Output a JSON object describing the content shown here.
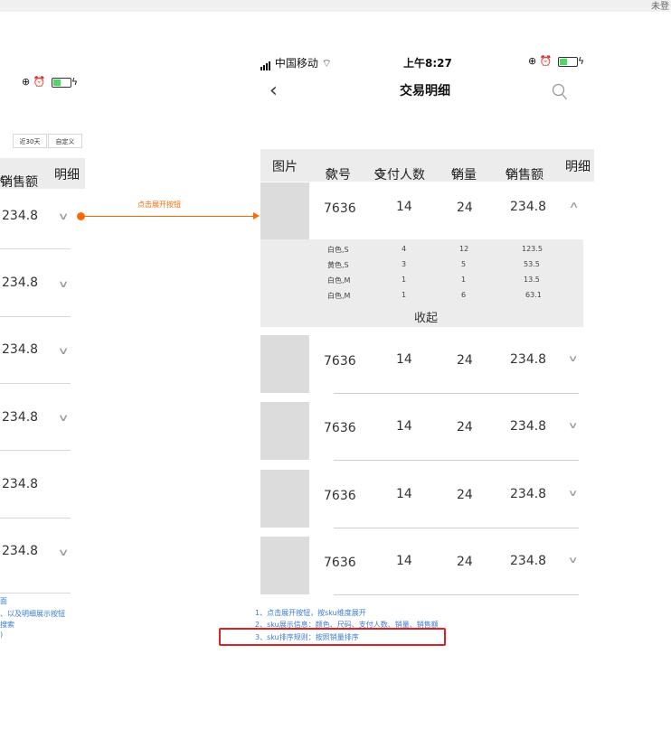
{
  "top_bar_text": "未登",
  "left_panel": {
    "filters": [
      "近30天",
      "自定义"
    ],
    "headers": {
      "sales_amount": "销售额",
      "detail": "明细"
    },
    "rows": [
      "234.8",
      "234.8",
      "234.8",
      "234.8",
      "234.8",
      "234.8"
    ],
    "notes": [
      "面",
      "、以及明细展示按钮",
      "搜索",
      ")"
    ]
  },
  "annotation": {
    "label": "点击展开按钮",
    "color": "#ff6a00"
  },
  "phone": {
    "carrier": "中国移动",
    "time": "上午8:27",
    "title": "交易明细",
    "headers": [
      "图片",
      "款号",
      "支付人数",
      "销量",
      "销售额",
      "明细"
    ],
    "rows": [
      {
        "code": "7636",
        "payers": "14",
        "sales": "24",
        "amount": "234.8"
      },
      {
        "code": "7636",
        "payers": "14",
        "sales": "24",
        "amount": "234.8"
      },
      {
        "code": "7636",
        "payers": "14",
        "sales": "24",
        "amount": "234.8"
      },
      {
        "code": "7636",
        "payers": "14",
        "sales": "24",
        "amount": "234.8"
      },
      {
        "code": "7636",
        "payers": "14",
        "sales": "24",
        "amount": "234.8"
      }
    ],
    "sku_rows": [
      {
        "sku": "白色,S",
        "payers": "4",
        "sales": "12",
        "amount": "123.5"
      },
      {
        "sku": "黄色,S",
        "payers": "3",
        "sales": "5",
        "amount": "53.5"
      },
      {
        "sku": "白色,M",
        "payers": "1",
        "sales": "1",
        "amount": "13.5"
      },
      {
        "sku": "白色,M",
        "payers": "1",
        "sales": "6",
        "amount": "63.1"
      }
    ],
    "collapse_label": "收起"
  },
  "notes": [
    "1、点击展开按钮，按sku维度展开",
    "2、sku展示信息：颜色、尺码、支付人数、销量、销售额",
    "3、sku排序规则：按照销量排序"
  ],
  "colors": {
    "accent": "#ff6a00",
    "note": "#3a7bd5",
    "highlight": "#e02020"
  }
}
